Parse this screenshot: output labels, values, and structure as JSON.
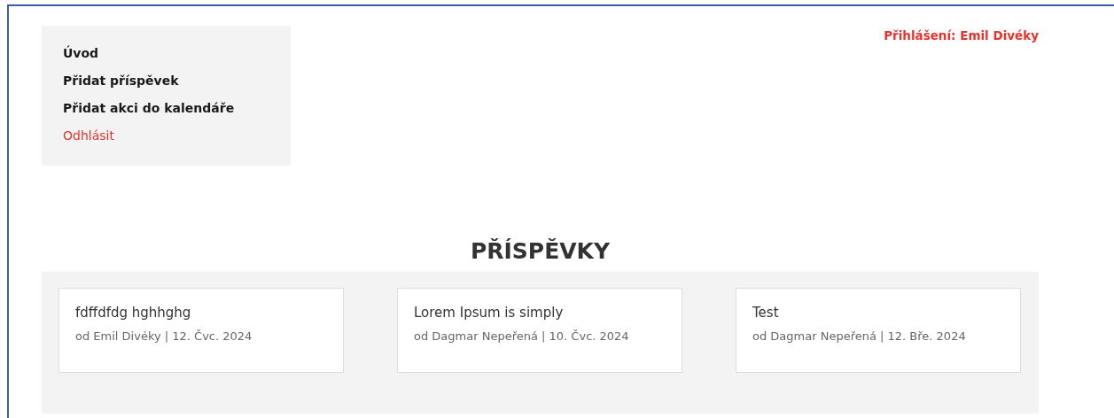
{
  "menu": [
    {
      "label": "Úvod",
      "kind": "link"
    },
    {
      "label": "Přidat příspěvek",
      "kind": "link"
    },
    {
      "label": "Přidat akci do kalendáře",
      "kind": "link"
    },
    {
      "label": "Odhlásit",
      "kind": "logout"
    }
  ],
  "login_status": "Přihlášení: Emil Divéky",
  "section_title": "PŘÍSPĚVKY",
  "posts": [
    {
      "title": "fdffdfdg hghhghg",
      "meta": "od Emil Divéky | 12. Čvc. 2024"
    },
    {
      "title": "Lorem Ipsum is simply",
      "meta": "od Dagmar Nepeřená | 10. Čvc. 2024"
    },
    {
      "title": "Test",
      "meta": "od Dagmar Nepeřená | 12. Bře. 2024"
    }
  ]
}
